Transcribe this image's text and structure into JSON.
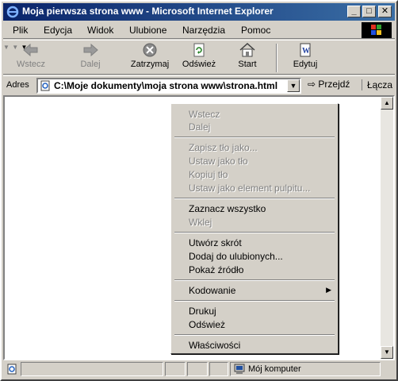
{
  "window": {
    "title": "Moja pierwsza strona www - Microsoft Internet Explorer",
    "minimize": "_",
    "maximize": "□",
    "close": "✕"
  },
  "menubar": {
    "items": [
      {
        "label": "Plik"
      },
      {
        "label": "Edycja"
      },
      {
        "label": "Widok"
      },
      {
        "label": "Ulubione"
      },
      {
        "label": "Narzędzia"
      },
      {
        "label": "Pomoc"
      }
    ]
  },
  "toolbar": {
    "back": "Wstecz",
    "forward": "Dalej",
    "stop": "Zatrzymaj",
    "refresh": "Odśwież",
    "home": "Start",
    "edit": "Edytuj"
  },
  "addressbar": {
    "label": "Adres",
    "url": "C:\\Moje dokumenty\\moja strona www\\strona.html",
    "go": "Przejdź",
    "links": "Łącza"
  },
  "context_menu": {
    "items": [
      {
        "label": "Wstecz",
        "enabled": false
      },
      {
        "label": "Dalej",
        "enabled": false
      },
      {
        "label": "Zapisz tło jako...",
        "enabled": false
      },
      {
        "label": "Ustaw jako tło",
        "enabled": false
      },
      {
        "label": "Kopiuj tło",
        "enabled": false
      },
      {
        "label": "Ustaw jako element pulpitu...",
        "enabled": false
      },
      {
        "label": "Zaznacz wszystko",
        "enabled": true
      },
      {
        "label": "Wklej",
        "enabled": false
      },
      {
        "label": "Utwórz skrót",
        "enabled": true
      },
      {
        "label": "Dodaj do ulubionych...",
        "enabled": true
      },
      {
        "label": "Pokaż źródło",
        "enabled": true
      },
      {
        "label": "Kodowanie",
        "enabled": true,
        "submenu": true
      },
      {
        "label": "Drukuj",
        "enabled": true
      },
      {
        "label": "Odśwież",
        "enabled": true
      },
      {
        "label": "Właściwości",
        "enabled": true
      }
    ]
  },
  "statusbar": {
    "zone": "Mój komputer"
  },
  "colors": {
    "title_start": "#0a246a",
    "title_end": "#3a6ea5",
    "face": "#d4d0c8"
  }
}
